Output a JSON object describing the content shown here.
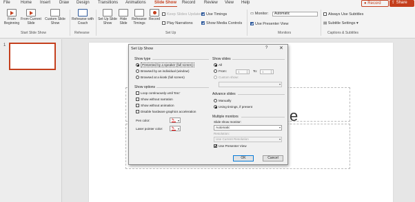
{
  "menu": {
    "tabs": [
      "File",
      "Home",
      "Insert",
      "Draw",
      "Design",
      "Transitions",
      "Animations",
      "Slide Show",
      "Record",
      "Review",
      "View",
      "Help"
    ],
    "active_tab": "Slide Show",
    "record_label": "Record",
    "share_label": "Share"
  },
  "ribbon": {
    "start": {
      "from_beginning": "From Beginning",
      "from_current": "From Current Slide",
      "custom": "Custom Slide Show",
      "group_label": "Start Slide Show"
    },
    "rehearse": {
      "label": "Rehearse with Coach",
      "group_label": "Rehearse"
    },
    "setup": {
      "set_up_show": "Set Up Slide Show",
      "hide_slide": "Hide Slide",
      "rehearse_timings": "Rehearse Timings",
      "record": "Record",
      "keep_updated": "Keep Slides Updated",
      "play_narrations": "Play Narrations",
      "use_timings": "Use Timings",
      "show_media_controls": "Show Media Controls",
      "group_label": "Set Up"
    },
    "monitors": {
      "monitor_label": "Monitor:",
      "monitor_value": "Automatic",
      "presenter_view": "Use Presenter View",
      "group_label": "Monitors"
    },
    "captions": {
      "always_subtitles": "Always Use Subtitles",
      "subtitle_settings": "Subtitle Settings",
      "group_label": "Captions & Subtitles"
    }
  },
  "thumbnails": {
    "slide_number": "1"
  },
  "canvas": {
    "title_fragment": "e"
  },
  "dialog": {
    "title": "Set Up Show",
    "help": "?",
    "close": "✕",
    "show_type": {
      "label": "Show type",
      "options": [
        "Presented by a speaker (full screen)",
        "Browsed by an individual (window)",
        "Browsed at a kiosk (full screen)"
      ]
    },
    "show_options": {
      "label": "Show options",
      "items": [
        "Loop continuously until 'Esc'",
        "Show without narration",
        "Show without animation",
        "Disable hardware graphics acceleration"
      ],
      "pen_color": "Pen color:",
      "laser_color": "Laser pointer color:"
    },
    "show_slides": {
      "label": "Show slides",
      "all": "All",
      "from": "From:",
      "to": "To:",
      "from_value": "1",
      "to_value": "1",
      "custom": "Custom show:"
    },
    "advance": {
      "label": "Advance slides",
      "manually": "Manually",
      "timings": "Using timings, if present"
    },
    "multiple_monitors": {
      "label": "Multiple monitors",
      "slide_show_monitor": "Slide show monitor:",
      "monitor_value": "Automatic",
      "resolution": "Resolution:",
      "resolution_value": "Use Current Resolution",
      "presenter_view": "Use Presenter View"
    },
    "ok": "OK",
    "cancel": "Cancel"
  }
}
